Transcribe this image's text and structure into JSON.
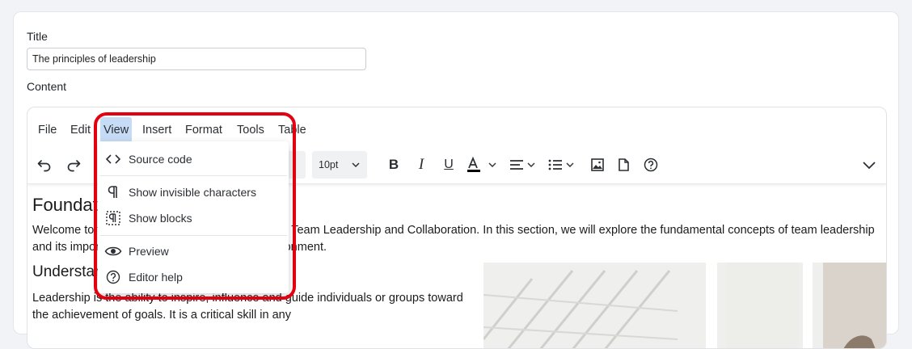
{
  "form": {
    "title_label": "Title",
    "title_value": "The principles of leadership",
    "content_label": "Content"
  },
  "menubar": {
    "items": [
      "File",
      "Edit",
      "View",
      "Insert",
      "Format",
      "Tools",
      "Table"
    ],
    "active": "View"
  },
  "toolbar": {
    "font_size": "10pt",
    "icons": [
      "undo-icon",
      "redo-icon",
      "bold-icon",
      "italic-icon",
      "underline-icon",
      "text-color-icon",
      "align-icon",
      "bullet-list-icon",
      "image-icon",
      "document-icon",
      "help-icon",
      "more-chevron-icon"
    ],
    "text_color": "#000000"
  },
  "view_menu": {
    "items": [
      {
        "label": "Source code",
        "icon": "source-code-icon"
      },
      {
        "label": "Show invisible characters",
        "icon": "pilcrow-icon"
      },
      {
        "label": "Show blocks",
        "icon": "show-blocks-icon"
      },
      {
        "label": "Preview",
        "icon": "eye-icon"
      },
      {
        "label": "Editor help",
        "icon": "help-icon"
      }
    ]
  },
  "content": {
    "heading_1": "Foundations of Leadership",
    "paragraph_1": "Welcome to the first module of our Introduction to Team Leadership and Collaboration. In this section, we will explore the fundamental concepts of team leadership and its importance in today’s dynamic work environment.",
    "heading_2": "Understanding Leadership",
    "paragraph_2": "Leadership is the ability to inspire, influence and guide individuals or groups toward the achievement of goals. It is a critical skill in any"
  },
  "colors": {
    "highlight": "#e3000f",
    "active_menu": "#c6dcf6"
  }
}
